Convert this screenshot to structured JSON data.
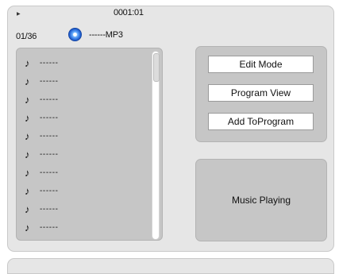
{
  "header": {
    "elapsed_time": "0001:01",
    "track_counter": "01/36",
    "file_type": "------MP3",
    "play_indicator": "▶"
  },
  "file_list": {
    "items": [
      {
        "label": "------",
        "icon": "music-note-icon"
      },
      {
        "label": "------",
        "icon": "music-note-icon"
      },
      {
        "label": "------",
        "icon": "music-note-icon"
      },
      {
        "label": "------",
        "icon": "music-note-icon"
      },
      {
        "label": "------",
        "icon": "music-note-icon"
      },
      {
        "label": "------",
        "icon": "music-note-icon"
      },
      {
        "label": "------",
        "icon": "music-note-icon"
      },
      {
        "label": "------",
        "icon": "music-note-icon"
      },
      {
        "label": "------",
        "icon": "music-note-icon"
      },
      {
        "label": "------",
        "icon": "music-note-icon"
      }
    ]
  },
  "buttons": {
    "edit_mode": "Edit Mode",
    "program_view": "Program View",
    "add_to_program": "Add ToProgram"
  },
  "status": {
    "text": "Music Playing"
  },
  "colors": {
    "panel_bg": "#e6e6e6",
    "inner_panel_bg": "#c6c6c6",
    "button_bg": "#ffffff",
    "disc_blue": "#1f5fd1"
  }
}
